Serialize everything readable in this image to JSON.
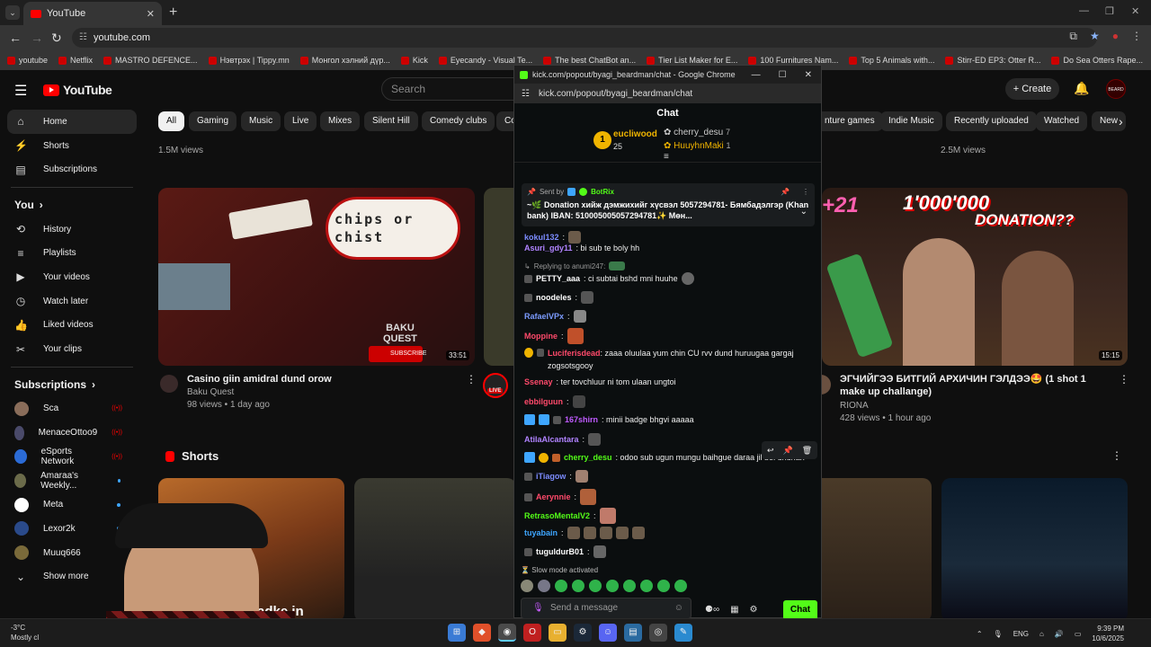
{
  "browser": {
    "tab_title": "YouTube",
    "url": "youtube.com",
    "bookmarks": [
      "youtube",
      "Netflix",
      "MASTRO DEFENCE...",
      "Нэвтрэх | Tippy.mn",
      "Монгол хэлний дүр...",
      "Kick",
      "Eyecandy - Visual Te...",
      "The best ChatBot an...",
      "Tier List Maker for E...",
      "100 Furnitures Nam...",
      "Top 5 Animals with...",
      "Stirr-ED EP3: Otter R...",
      "Do Sea Otters Rape..."
    ]
  },
  "youtube": {
    "logo": "YouTube",
    "search_placeholder": "Search",
    "create_label": "Create",
    "avatar_text": "BEARD",
    "sidebar": {
      "home": "Home",
      "shorts": "Shorts",
      "subscriptions": "Subscriptions",
      "you": "You",
      "history": "History",
      "playlists": "Playlists",
      "your_videos": "Your videos",
      "watch_later": "Watch later",
      "liked_videos": "Liked videos",
      "your_clips": "Your clips",
      "subs_header": "Subscriptions",
      "subs": [
        "Sca",
        "MenaceOttoo9",
        "eSports Network",
        "Amaraa's Weekly...",
        "Meta",
        "Lexor2k",
        "Muuq666"
      ],
      "show_more": "Show more"
    },
    "chips": [
      "All",
      "Gaming",
      "Music",
      "Live",
      "Mixes",
      "Silent Hill",
      "Comedy clubs",
      "Co",
      "nture games",
      "Indie Music",
      "Recently uploaded",
      "Watched",
      "New"
    ],
    "top_views_left": "1.5M views",
    "top_views_right": "2.5M views",
    "video1": {
      "title": "Casino giin amidral dund orow",
      "channel": "Baku Quest",
      "meta": "98 views • 1 day ago",
      "duration": "33:51",
      "thumb_text_1": "chips or",
      "thumb_text_2": "chist",
      "thumb_brand_1": "BAKU",
      "thumb_brand_2": "QUEST",
      "subscribe": "SUBSCRIBE"
    },
    "video2": {
      "title": "ЭГЧИЙГЭЭ БИТГИЙ АРХИЧИН ГЭЛДЭЭ🤩 (1 shot 1 make up challange)",
      "channel": "RIONA",
      "meta": "428 views • 1 hour ago",
      "duration": "15:15",
      "thumb_text_1": "1'000'000",
      "thumb_text_2": "DONATION??",
      "thumb_text_3": "+21"
    },
    "live_label": "LIVE",
    "shorts_header": "Shorts",
    "short_caption": "adke in"
  },
  "popup": {
    "title": "kick.com/popout/byagi_beardman/chat - Google Chrome",
    "url": "kick.com/popout/byagi_beardman/chat",
    "chat_header": "Chat",
    "leaderboard": {
      "first_name": "eucliwood",
      "first_count": "25",
      "second_name": "cherry_desu",
      "second_count": "7",
      "third_name": "HuuyhnMaki",
      "third_count": "1"
    },
    "pinned": {
      "sent_by": "Sent by",
      "bot": "BotRix",
      "message": "~🌿 Donation хийж дэмжихийг хүсвэл 5057294781- Бямбадэлгэр (Khan bank) IBAN: 510005005057294781✨ Мөн..."
    },
    "messages": [
      {
        "user": "kokul132",
        "text": ":",
        "color": "#7c8cff"
      },
      {
        "user": "Asuri_gdy11",
        "text": ": bi sub te boly hh",
        "color": "#b083ff"
      },
      {
        "reply": "Replying to anumi247:"
      },
      {
        "user": "PETTY_aaa",
        "text": ": ci subtai bshd mni huuhe",
        "color": "#fff"
      },
      {
        "user": "noodeles",
        "text": ":",
        "color": "#fff"
      },
      {
        "user": "RafaelVPx",
        "text": ":",
        "color": "#7c9cff"
      },
      {
        "user": "Moppine",
        "text": ":",
        "color": "#ff4a6b"
      },
      {
        "user": "Luciferisdead",
        "text": ": zaaa oluulaa yum chin CU rvv dund huruugaa gargaj zogsotsgooy",
        "color": "#ff4a6b"
      },
      {
        "user": "Ssenay",
        "text": ": ter tovchluur ni tom ulaan ungtoi",
        "color": "#ff4a6b"
      },
      {
        "user": "ebbilguun",
        "text": ":",
        "color": "#ff4a6b"
      },
      {
        "user": "167shirn",
        "text": ": minii badge bhgvi aaaaa",
        "color": "#c05bff"
      },
      {
        "user": "AtilaAlcantara",
        "text": ":",
        "color": "#b083ff"
      },
      {
        "user": "cherry_desu",
        "text": ": odoo sub ugun mungu baihgue daraa jil bol unuhan",
        "color": "#53fc18"
      },
      {
        "user": "iTiagow",
        "text": ":",
        "color": "#7c8cff"
      },
      {
        "user": "Aerynnie",
        "text": ":",
        "color": "#ff4a6b"
      },
      {
        "user": "RetrasoMentalV2",
        "text": ":",
        "color": "#53fc18"
      },
      {
        "user": "tuyabain",
        "text": ":",
        "color": "#3ea6ff"
      },
      {
        "user": "tuguldurB01",
        "text": ":",
        "color": "#fff"
      }
    ],
    "slow_mode": "Slow mode activated",
    "input_placeholder": "Send a message",
    "chat_button": "Chat"
  },
  "taskbar": {
    "temp": "-3°C",
    "weather": "Mostly cl",
    "lang": "ENG",
    "time": "9:39 PM",
    "date": "10/6/2025"
  },
  "colors": {
    "kick_green": "#53fc18",
    "yt_red": "#ff0000",
    "bg": "#0f0f0f"
  }
}
